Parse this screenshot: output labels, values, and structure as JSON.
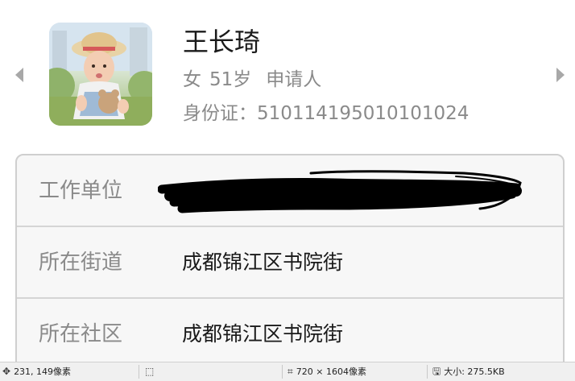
{
  "profile": {
    "name": "王长琦",
    "gender": "女",
    "age": "51岁",
    "role": "申请人",
    "id_card": "身份证：510114195010101024"
  },
  "details": [
    {
      "label": "工作单位",
      "value": ""
    },
    {
      "label": "所在街道",
      "value": "成都锦江区书院街"
    },
    {
      "label": "所在社区",
      "value": "成都锦江区书院街"
    }
  ],
  "statusbar": {
    "cursor": "231, 149像素",
    "dimensions": "720 × 1604像素",
    "filesize": "大小: 275.5KB"
  },
  "icons": {
    "cursor": "move-crosshair-icon",
    "selection": "selection-icon",
    "dimensions": "crop-icon",
    "filesize": "save-icon"
  },
  "colors": {
    "label_gray": "#8a8a8a",
    "text_dark": "#1a1a1a",
    "card_bg": "#f7f7f7",
    "card_border": "#cfcfcf",
    "arrow": "#a8a8a8",
    "redaction": "#000000"
  }
}
